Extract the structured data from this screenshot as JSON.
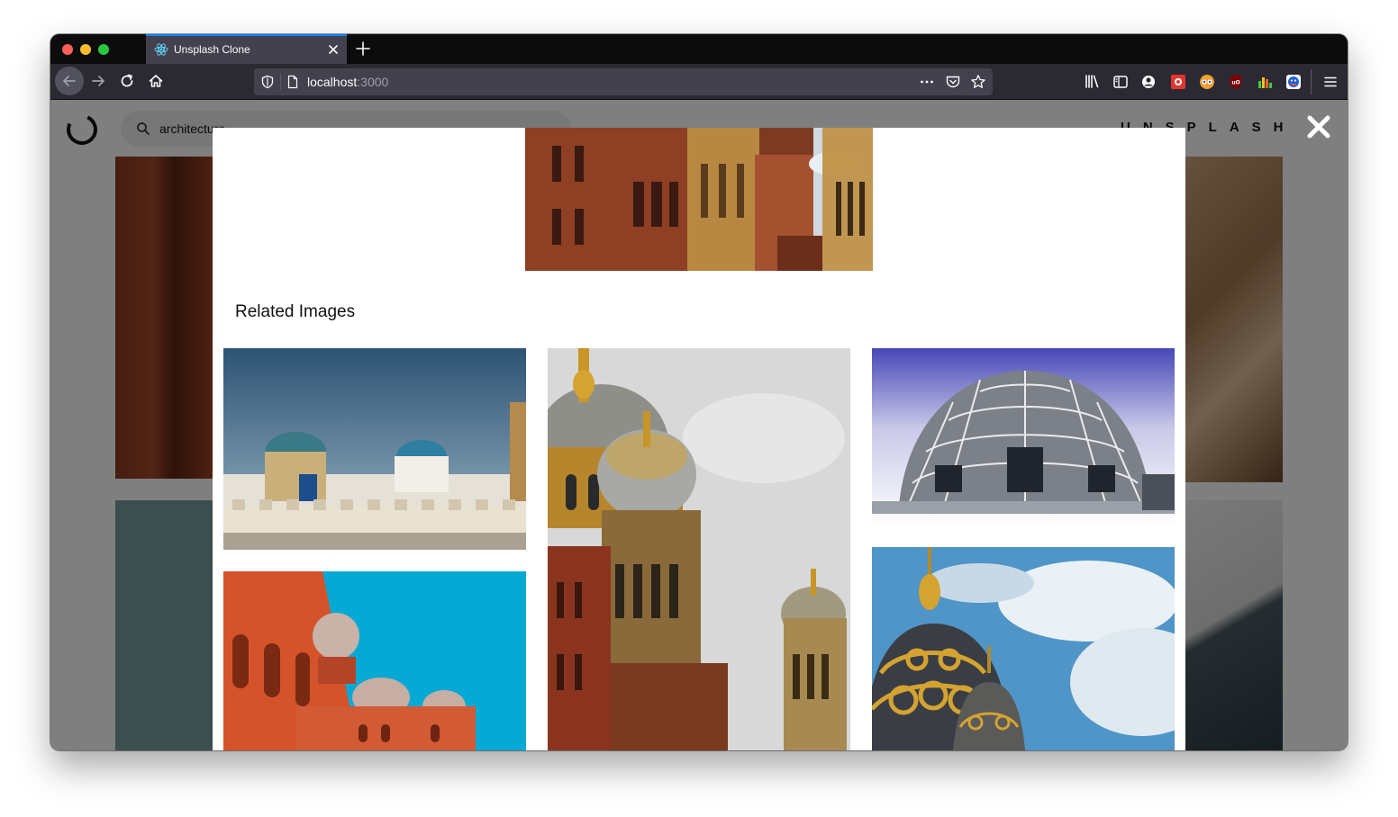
{
  "browser": {
    "tab_title": "Unsplash Clone",
    "url_host": "localhost",
    "url_port": ":3000"
  },
  "app": {
    "search_value": "architecture",
    "brand_text": "UNSPLASH"
  },
  "modal": {
    "related_title": "Related Images"
  },
  "icons": {
    "tab": "react-icon",
    "close_tab": "close-icon",
    "new_tab": "plus-icon",
    "back": "arrow-left-icon",
    "forward": "arrow-right-icon",
    "reload": "reload-icon",
    "home": "home-icon",
    "library": "library-icon",
    "sidebar": "sidebar-icon",
    "account": "account-icon",
    "menu": "hamburger-menu-icon",
    "modal_close": "close-x-icon"
  }
}
